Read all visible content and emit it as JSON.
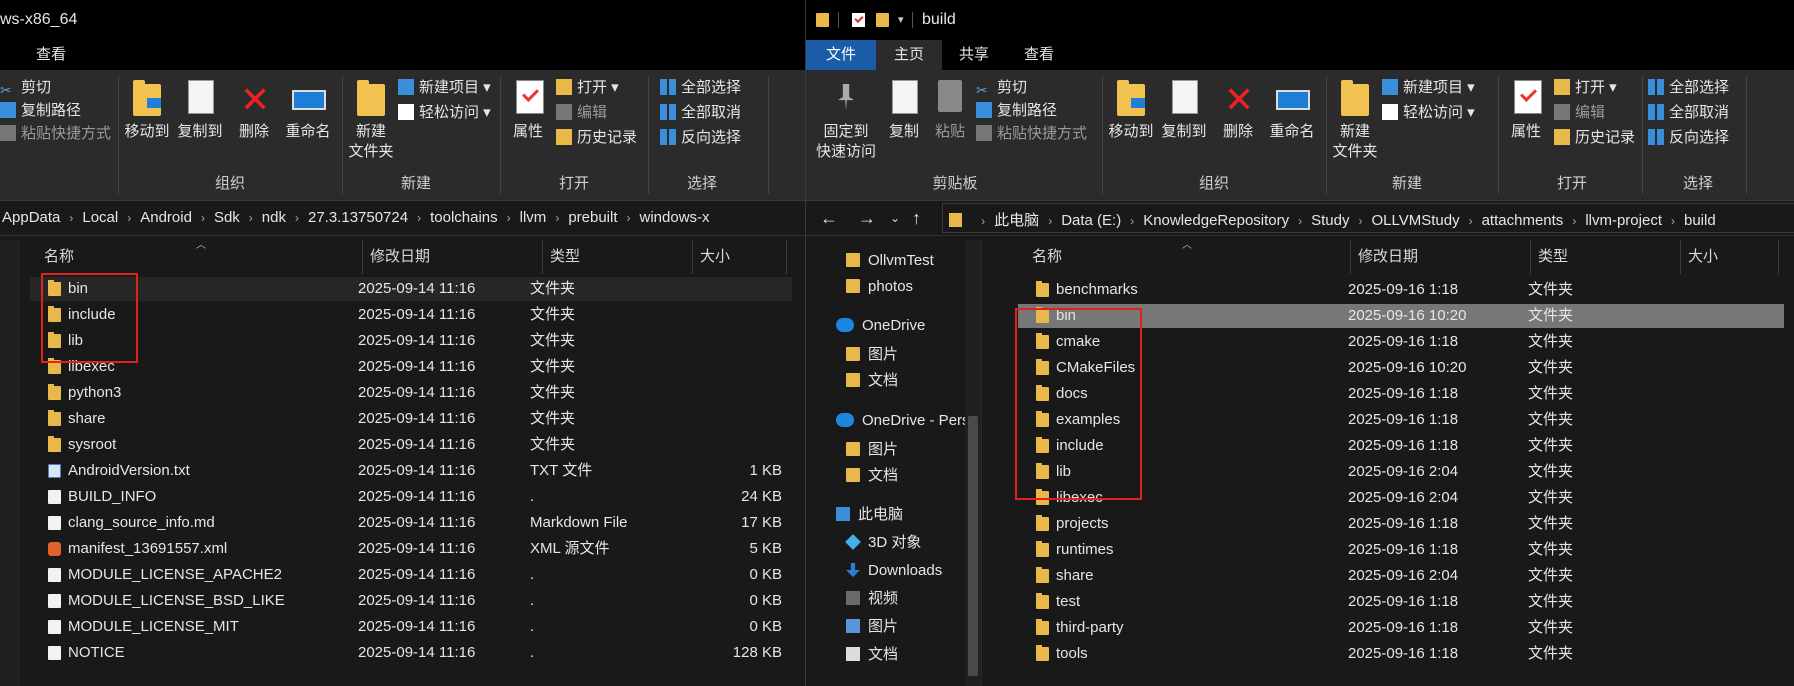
{
  "left": {
    "title": "ws-x86_64",
    "tabs": {
      "view": "查看"
    },
    "ribbon": {
      "cut": "剪切",
      "copy_path": "复制路径",
      "paste_shortcut": "粘贴快捷方式",
      "move_to": "移动到",
      "copy_to": "复制到",
      "delete": "删除",
      "rename": "重命名",
      "new_folder": "新建\n文件夹",
      "new_item": "新建项目 ▾",
      "easy_access": "轻松访问 ▾",
      "properties": "属性",
      "open": "打开 ▾",
      "edit": "编辑",
      "history": "历史记录",
      "select_all": "全部选择",
      "select_none": "全部取消",
      "invert_selection": "反向选择",
      "groups": {
        "organize": "组织",
        "new": "新建",
        "open": "打开",
        "select": "选择"
      }
    },
    "breadcrumb": [
      "AppData",
      "Local",
      "Android",
      "Sdk",
      "ndk",
      "27.3.13750724",
      "toolchains",
      "llvm",
      "prebuilt",
      "windows-x"
    ],
    "columns": {
      "name": "名称",
      "modified": "修改日期",
      "type": "类型",
      "size": "大小"
    },
    "rows": [
      {
        "name": "bin",
        "date": "2025-09-14 11:16",
        "type": "文件夹",
        "size": "",
        "icon": "folder"
      },
      {
        "name": "include",
        "date": "2025-09-14 11:16",
        "type": "文件夹",
        "size": "",
        "icon": "folder"
      },
      {
        "name": "lib",
        "date": "2025-09-14 11:16",
        "type": "文件夹",
        "size": "",
        "icon": "folder"
      },
      {
        "name": "libexec",
        "date": "2025-09-14 11:16",
        "type": "文件夹",
        "size": "",
        "icon": "folder"
      },
      {
        "name": "python3",
        "date": "2025-09-14 11:16",
        "type": "文件夹",
        "size": "",
        "icon": "folder"
      },
      {
        "name": "share",
        "date": "2025-09-14 11:16",
        "type": "文件夹",
        "size": "",
        "icon": "folder"
      },
      {
        "name": "sysroot",
        "date": "2025-09-14 11:16",
        "type": "文件夹",
        "size": "",
        "icon": "folder"
      },
      {
        "name": "AndroidVersion.txt",
        "date": "2025-09-14 11:16",
        "type": "TXT 文件",
        "size": "1 KB",
        "icon": "txt"
      },
      {
        "name": "BUILD_INFO",
        "date": "2025-09-14 11:16",
        "type": ".",
        "size": "24 KB",
        "icon": "file"
      },
      {
        "name": "clang_source_info.md",
        "date": "2025-09-14 11:16",
        "type": "Markdown File",
        "size": "17 KB",
        "icon": "md"
      },
      {
        "name": "manifest_13691557.xml",
        "date": "2025-09-14 11:16",
        "type": "XML 源文件",
        "size": "5 KB",
        "icon": "xml"
      },
      {
        "name": "MODULE_LICENSE_APACHE2",
        "date": "2025-09-14 11:16",
        "type": ".",
        "size": "0 KB",
        "icon": "file"
      },
      {
        "name": "MODULE_LICENSE_BSD_LIKE",
        "date": "2025-09-14 11:16",
        "type": ".",
        "size": "0 KB",
        "icon": "file"
      },
      {
        "name": "MODULE_LICENSE_MIT",
        "date": "2025-09-14 11:16",
        "type": ".",
        "size": "0 KB",
        "icon": "file"
      },
      {
        "name": "NOTICE",
        "date": "2025-09-14 11:16",
        "type": ".",
        "size": "128 KB",
        "icon": "file"
      }
    ]
  },
  "right": {
    "title": "build",
    "tabs": {
      "file": "文件",
      "home": "主页",
      "share": "共享",
      "view": "查看"
    },
    "ribbon": {
      "pin": "固定到\n快速访问",
      "copy": "复制",
      "paste": "粘贴",
      "cut": "剪切",
      "copy_path": "复制路径",
      "paste_shortcut": "粘贴快捷方式",
      "move_to": "移动到",
      "copy_to": "复制到",
      "delete": "删除",
      "rename": "重命名",
      "new_folder": "新建\n文件夹",
      "new_item": "新建项目 ▾",
      "easy_access": "轻松访问 ▾",
      "properties": "属性",
      "open": "打开 ▾",
      "edit": "编辑",
      "history": "历史记录",
      "select_all": "全部选择",
      "select_none": "全部取消",
      "invert_selection": "反向选择",
      "groups": {
        "clipboard": "剪贴板",
        "organize": "组织",
        "new": "新建",
        "open": "打开",
        "select": "选择"
      }
    },
    "breadcrumb": [
      "此电脑",
      "Data (E:)",
      "KnowledgeRepository",
      "Study",
      "OLLVMStudy",
      "attachments",
      "llvm-project",
      "build"
    ],
    "sidebar": [
      {
        "label": "OllvmTest",
        "icon": "folder",
        "indent": 1
      },
      {
        "label": "photos",
        "icon": "folder",
        "indent": 1
      },
      {
        "label": "OneDrive",
        "icon": "cloud",
        "indent": 0
      },
      {
        "label": "图片",
        "icon": "folder",
        "indent": 1
      },
      {
        "label": "文档",
        "icon": "folder",
        "indent": 1
      },
      {
        "label": "OneDrive - Perso",
        "icon": "cloud",
        "indent": 0
      },
      {
        "label": "图片",
        "icon": "folder",
        "indent": 1
      },
      {
        "label": "文档",
        "icon": "folder",
        "indent": 1
      },
      {
        "label": "此电脑",
        "icon": "pc",
        "indent": 0
      },
      {
        "label": "3D 对象",
        "icon": "cube",
        "indent": 1
      },
      {
        "label": "Downloads",
        "icon": "down",
        "indent": 1
      },
      {
        "label": "视频",
        "icon": "video",
        "indent": 1
      },
      {
        "label": "图片",
        "icon": "pic",
        "indent": 1
      },
      {
        "label": "文档",
        "icon": "doc",
        "indent": 1
      }
    ],
    "columns": {
      "name": "名称",
      "modified": "修改日期",
      "type": "类型",
      "size": "大小"
    },
    "rows": [
      {
        "name": "benchmarks",
        "date": "2025-09-16 1:18",
        "type": "文件夹"
      },
      {
        "name": "bin",
        "date": "2025-09-16 10:20",
        "type": "文件夹"
      },
      {
        "name": "cmake",
        "date": "2025-09-16 1:18",
        "type": "文件夹"
      },
      {
        "name": "CMakeFiles",
        "date": "2025-09-16 10:20",
        "type": "文件夹"
      },
      {
        "name": "docs",
        "date": "2025-09-16 1:18",
        "type": "文件夹"
      },
      {
        "name": "examples",
        "date": "2025-09-16 1:18",
        "type": "文件夹"
      },
      {
        "name": "include",
        "date": "2025-09-16 1:18",
        "type": "文件夹"
      },
      {
        "name": "lib",
        "date": "2025-09-16 2:04",
        "type": "文件夹"
      },
      {
        "name": "libexec",
        "date": "2025-09-16 2:04",
        "type": "文件夹"
      },
      {
        "name": "projects",
        "date": "2025-09-16 1:18",
        "type": "文件夹"
      },
      {
        "name": "runtimes",
        "date": "2025-09-16 1:18",
        "type": "文件夹"
      },
      {
        "name": "share",
        "date": "2025-09-16 2:04",
        "type": "文件夹"
      },
      {
        "name": "test",
        "date": "2025-09-16 1:18",
        "type": "文件夹"
      },
      {
        "name": "third-party",
        "date": "2025-09-16 1:18",
        "type": "文件夹"
      },
      {
        "name": "tools",
        "date": "2025-09-16 1:18",
        "type": "文件夹"
      }
    ]
  },
  "colors": {
    "file_tab": "#1a5ca8",
    "highlight_box": "#e0221e",
    "folder": "#e8b84a",
    "selected_row": "#777777"
  }
}
